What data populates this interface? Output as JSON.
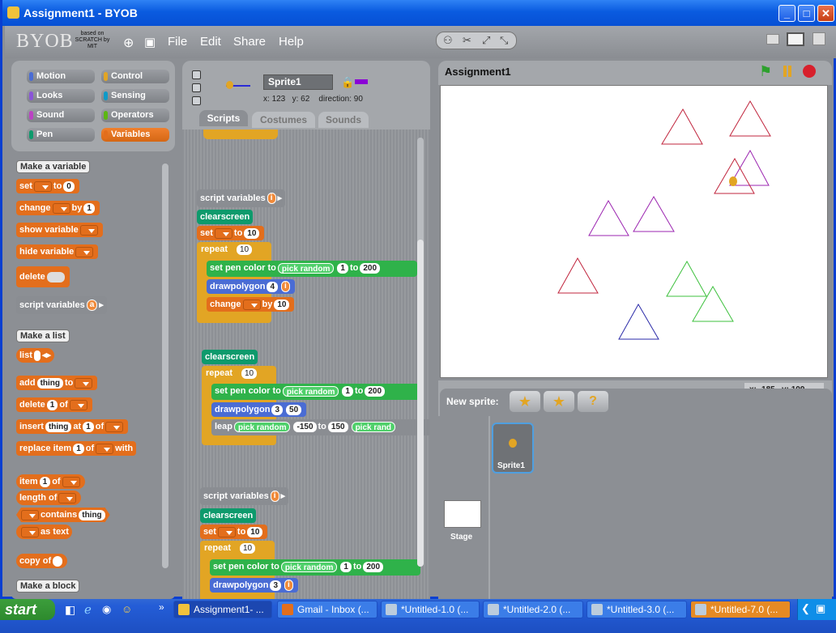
{
  "window": {
    "title": "Assignment1 - BYOB"
  },
  "menubar": {
    "logo": "BYOB",
    "logo_sub": "based on SCRATCH by MIT",
    "items": [
      "File",
      "Edit",
      "Share",
      "Help"
    ]
  },
  "categories": [
    {
      "label": "Motion",
      "color": "#4a6cd4",
      "active": false
    },
    {
      "label": "Control",
      "color": "#e2a524",
      "active": false
    },
    {
      "label": "Looks",
      "color": "#8a55d7",
      "active": false
    },
    {
      "label": "Sensing",
      "color": "#0e9ac8",
      "active": false
    },
    {
      "label": "Sound",
      "color": "#bb42c3",
      "active": false
    },
    {
      "label": "Operators",
      "color": "#5cb712",
      "active": false
    },
    {
      "label": "Pen",
      "color": "#0e9a6c",
      "active": false
    },
    {
      "label": "Variables",
      "color": "#e36e1c",
      "active": true
    }
  ],
  "palette": {
    "make_variable": "Make a variable",
    "set": "set",
    "to": "to",
    "set_val": "0",
    "change": "change",
    "by": "by",
    "change_val": "1",
    "show_variable": "show variable",
    "hide_variable": "hide variable",
    "delete": "delete",
    "script_variables": "script variables",
    "sv_arg": "a",
    "make_list": "Make a list",
    "list": "list",
    "add": "add",
    "add_item": "thing",
    "delete_of": "delete",
    "of": "of",
    "one": "1",
    "insert": "insert",
    "at": "at",
    "replace_item": "replace item",
    "with": "with",
    "item": "item",
    "length_of": "length of",
    "contains": "contains",
    "as_text": "as text",
    "copy_of": "copy of",
    "make_block": "Make a block"
  },
  "sprite": {
    "name": "Sprite1",
    "x_label": "x:",
    "x": "123",
    "y_label": "y:",
    "y": "62",
    "dir_label": "direction:",
    "direction": "90"
  },
  "tabs": [
    "Scripts",
    "Costumes",
    "Sounds"
  ],
  "scripts": {
    "script_variables": "script variables",
    "var_i": "i",
    "clearscreen": "clearscreen",
    "set": "set",
    "to": "to",
    "ten": "10",
    "repeat": "repeat",
    "set_pen_color_to": "set pen color to",
    "pick_random": "pick random",
    "one": "1",
    "two_hundred": "200",
    "drawpolygon": "drawpolygon",
    "four": "4",
    "change": "change",
    "by": "by",
    "three": "3",
    "fifty": "50",
    "leap": "leap",
    "neg150": "-150",
    "one_fifty": "150",
    "pick_rand_trunc": "pick rand"
  },
  "stage": {
    "title": "Assignment1",
    "mouse_x_label": "x:",
    "mouse_x": "-185",
    "mouse_y_label": "y:",
    "mouse_y": "109"
  },
  "triangles": [
    {
      "color": "#c0243c"
    },
    {
      "color": "#c0243c"
    },
    {
      "color": "#9b24b0"
    },
    {
      "color": "#c0243c"
    },
    {
      "color": "#9b24b0"
    },
    {
      "color": "#9b24b0"
    },
    {
      "color": "#c0243c"
    },
    {
      "color": "#3cc03c"
    },
    {
      "color": "#3cc03c"
    },
    {
      "color": "#2a2aa8"
    }
  ],
  "sprite_area": {
    "new_sprite": "New sprite:",
    "sprite_label": "Sprite1",
    "stage_label": "Stage"
  },
  "taskbar": {
    "start": "start",
    "tasks": [
      "Assignment1- ...",
      "Gmail - Inbox (...",
      "*Untitled-1.0 (...",
      "*Untitled-2.0 (...",
      "*Untitled-3.0 (...",
      "*Untitled-7.0 (..."
    ]
  }
}
